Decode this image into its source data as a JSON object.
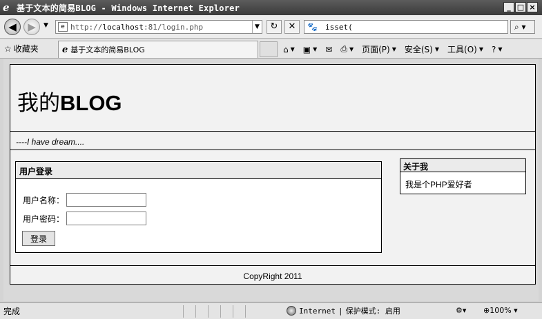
{
  "window": {
    "title": "基于文本的简易BLOG - Windows Internet Explorer",
    "minimize": "_",
    "maximize": "□",
    "close": "×"
  },
  "navbar": {
    "back_glyph": "◀",
    "forward_glyph": "▶",
    "address_prefix": "http://",
    "address_host": "localhost",
    "address_rest": ":81/login.php",
    "refresh_glyph": "↻",
    "stop_glyph": "✕",
    "search_value": "isset(",
    "search_glyph": "⌕"
  },
  "favorites": {
    "label": "收藏夹",
    "tab_title": "基于文本的简易BLOG",
    "commands": [
      {
        "label": "页面(P)"
      },
      {
        "label": "安全(S)"
      },
      {
        "label": "工具(O)"
      }
    ],
    "help": "?"
  },
  "page": {
    "blog_title_cn": "我的",
    "blog_title_en": "BLOG",
    "motto": "----I have dream....",
    "login": {
      "heading": "用户登录",
      "username_label": "用户名称：",
      "password_label": "用户密码：",
      "username_value": "",
      "password_value": "",
      "submit_label": "登录"
    },
    "about": {
      "heading": "关于我",
      "text": "我是个PHP爱好者"
    },
    "footer": "CopyRight 2011"
  },
  "statusbar": {
    "status": "完成",
    "zone": "Internet",
    "protected_mode": "保护模式: 启用",
    "zoom": "100%"
  }
}
